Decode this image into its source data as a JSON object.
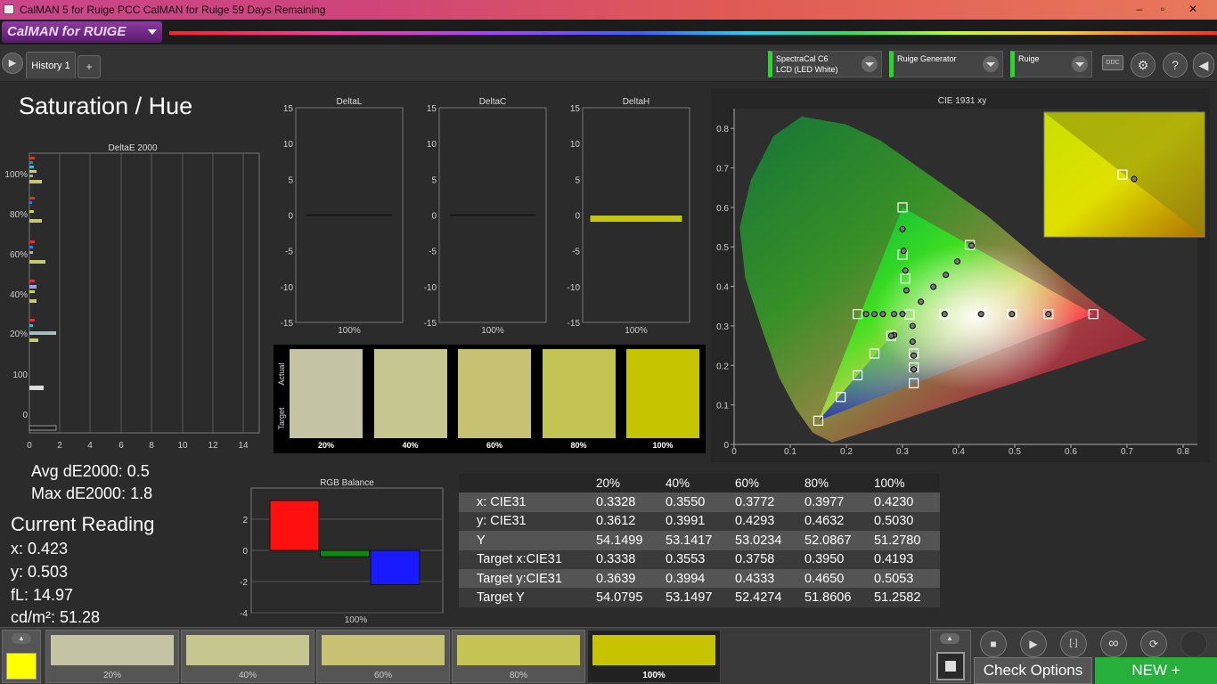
{
  "window": {
    "title": "CalMAN 5 for Ruige PCC CalMAN for Ruige 59 Days Remaining",
    "minimize": "–",
    "restore": "▫",
    "close": "✕"
  },
  "brand": {
    "logo": "CalMAN for RUIGE"
  },
  "tabs": {
    "active": "History 1",
    "add": "+"
  },
  "devices": [
    {
      "line1": "SpectraCal C6",
      "line2": "LCD (LED White)"
    },
    {
      "line1": "Ruige Generator",
      "line2": ""
    },
    {
      "line1": "Ruige",
      "line2": ""
    }
  ],
  "toolbar": {
    "ddc": "DDC",
    "help": "?"
  },
  "page": {
    "title": "Saturation / Hue"
  },
  "deltae_chart": {
    "title": "DeltaE 2000",
    "y_labels": [
      "100%",
      "80%",
      "60%",
      "40%",
      "20%",
      "100",
      "0"
    ],
    "x_labels": [
      "0",
      "2",
      "4",
      "6",
      "8",
      "10",
      "12",
      "14"
    ]
  },
  "delta_charts": [
    {
      "title": "DeltaL",
      "value": 0.0,
      "category": "100%"
    },
    {
      "title": "DeltaC",
      "value": 0.0,
      "category": "100%"
    },
    {
      "title": "DeltaH",
      "value": -1.0,
      "category": "100%"
    }
  ],
  "delta_axis": {
    "ticks": [
      "15",
      "10",
      "5",
      "0",
      "-5",
      "-10",
      "-15"
    ]
  },
  "swatches": {
    "actual_label": "Actual",
    "target_label": "Target",
    "items": [
      {
        "label": "20%",
        "actual": "#c4c4a4",
        "target": "#c4c4a4"
      },
      {
        "label": "40%",
        "actual": "#c6c690",
        "target": "#c6c690"
      },
      {
        "label": "60%",
        "actual": "#c7c273",
        "target": "#c7c273"
      },
      {
        "label": "80%",
        "actual": "#c4c454",
        "target": "#c4c454"
      },
      {
        "label": "100%",
        "actual": "#c6c400",
        "target": "#c6c400"
      }
    ]
  },
  "stats": {
    "avg": "Avg dE2000: 0.5",
    "max": "Max dE2000: 1.8"
  },
  "current_reading": {
    "title": "Current Reading",
    "x": "x: 0.423",
    "y": "y: 0.503",
    "fl": "fL: 14.97",
    "cdm2": "cd/m²: 51.28"
  },
  "chart_data": [
    {
      "type": "bar",
      "title": "RGB Balance",
      "categories": [
        "100%"
      ],
      "series": [
        {
          "name": "R",
          "values": [
            3.2
          ],
          "color": "#ff1010"
        },
        {
          "name": "G",
          "values": [
            -0.4
          ],
          "color": "#0d8a0d"
        },
        {
          "name": "B",
          "values": [
            -2.2
          ],
          "color": "#1a1aff"
        }
      ],
      "ylim": [
        -4,
        4
      ],
      "y_ticks": [
        "2",
        "0",
        "-2",
        "-4"
      ],
      "xlabel": "100%"
    },
    {
      "type": "scatter",
      "title": "CIE 1931 xy",
      "x_ticks": [
        "0",
        "0.1",
        "0.2",
        "0.3",
        "0.4",
        "0.5",
        "0.6",
        "0.7",
        "0.8"
      ],
      "y_ticks": [
        "0",
        "0.1",
        "0.2",
        "0.3",
        "0.4",
        "0.5",
        "0.6",
        "0.7",
        "0.8"
      ],
      "xlim": [
        0,
        0.8
      ],
      "ylim": [
        0,
        0.85
      ],
      "targets": [
        [
          0.64,
          0.33
        ],
        [
          0.56,
          0.33
        ],
        [
          0.495,
          0.33
        ],
        [
          0.44,
          0.33
        ],
        [
          0.375,
          0.33
        ],
        [
          0.3,
          0.6
        ],
        [
          0.3,
          0.48
        ],
        [
          0.305,
          0.42
        ],
        [
          0.15,
          0.06
        ],
        [
          0.19,
          0.12
        ],
        [
          0.22,
          0.175
        ],
        [
          0.25,
          0.23
        ],
        [
          0.28,
          0.275
        ],
        [
          0.42,
          0.505
        ],
        [
          0.3127,
          0.329
        ],
        [
          0.22,
          0.33
        ],
        [
          0.32,
          0.155
        ],
        [
          0.32,
          0.195
        ],
        [
          0.32,
          0.23
        ]
      ],
      "measured": [
        [
          0.3328,
          0.3612
        ],
        [
          0.355,
          0.3991
        ],
        [
          0.3772,
          0.4293
        ],
        [
          0.3977,
          0.4632
        ],
        [
          0.423,
          0.503
        ],
        [
          0.3,
          0.545
        ],
        [
          0.302,
          0.49
        ],
        [
          0.305,
          0.44
        ],
        [
          0.307,
          0.39
        ],
        [
          0.375,
          0.33
        ],
        [
          0.44,
          0.33
        ],
        [
          0.495,
          0.33
        ],
        [
          0.56,
          0.33
        ],
        [
          0.235,
          0.33
        ],
        [
          0.25,
          0.33
        ],
        [
          0.265,
          0.33
        ],
        [
          0.285,
          0.33
        ],
        [
          0.3,
          0.33
        ],
        [
          0.285,
          0.277
        ],
        [
          0.28,
          0.275
        ],
        [
          0.318,
          0.3
        ],
        [
          0.318,
          0.26
        ],
        [
          0.32,
          0.225
        ],
        [
          0.32,
          0.19
        ]
      ],
      "inset": {
        "target": [
          0.42,
          0.505
        ],
        "measured": [
          0.423,
          0.503
        ]
      }
    }
  ],
  "table": {
    "headers": [
      "",
      "20%",
      "40%",
      "60%",
      "80%",
      "100%"
    ],
    "rows": [
      [
        "x: CIE31",
        "0.3328",
        "0.3550",
        "0.3772",
        "0.3977",
        "0.4230"
      ],
      [
        "y: CIE31",
        "0.3612",
        "0.3991",
        "0.4293",
        "0.4632",
        "0.5030"
      ],
      [
        "Y",
        "54.1499",
        "53.1417",
        "53.0234",
        "52.0867",
        "51.2780"
      ],
      [
        "Target x:CIE31",
        "0.3338",
        "0.3553",
        "0.3758",
        "0.3950",
        "0.4193"
      ],
      [
        "Target y:CIE31",
        "0.3639",
        "0.3994",
        "0.4333",
        "0.4650",
        "0.5053"
      ],
      [
        "Target Y",
        "54.0795",
        "53.1497",
        "52.4274",
        "51.8606",
        "51.2582"
      ]
    ]
  },
  "strip": {
    "current_color": "#ffff00",
    "items": [
      {
        "label": "20%",
        "color": "#c4c4a4"
      },
      {
        "label": "40%",
        "color": "#c6c690"
      },
      {
        "label": "60%",
        "color": "#c7c273"
      },
      {
        "label": "80%",
        "color": "#c4c454"
      },
      {
        "label": "100%",
        "color": "#c6c400"
      }
    ]
  },
  "buttons": {
    "check": "Check Options",
    "new": "NEW +"
  }
}
